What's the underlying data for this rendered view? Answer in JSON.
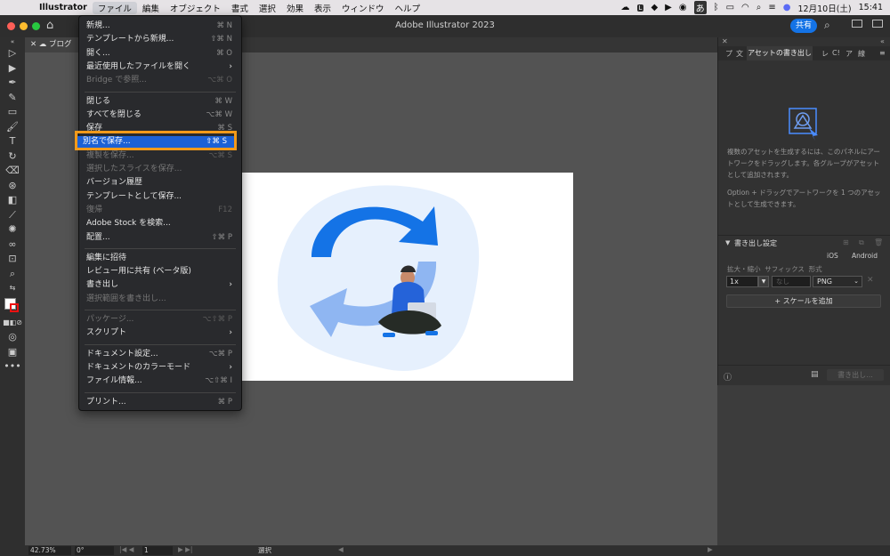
{
  "menubar": {
    "app_name": "Illustrator",
    "items": [
      "ファイル",
      "編集",
      "オブジェクト",
      "書式",
      "選択",
      "効果",
      "表示",
      "ウィンドウ",
      "ヘルプ"
    ],
    "ime": "あ",
    "date": "12月10日(土)",
    "time": "15:41"
  },
  "window": {
    "title": "Adobe Illustrator 2023",
    "share_label": "共有"
  },
  "tab": {
    "doc_name": "ブログ"
  },
  "file_menu": {
    "items": [
      {
        "label": "新規...",
        "shortcut": "⌘ N",
        "disabled": false
      },
      {
        "label": "テンプレートから新規...",
        "shortcut": "⇧⌘ N",
        "disabled": false
      },
      {
        "label": "開く...",
        "shortcut": "⌘ O",
        "disabled": false
      },
      {
        "label": "最近使用したファイルを開く",
        "shortcut": "",
        "submenu": true,
        "disabled": false
      },
      {
        "label": "Bridge で参照...",
        "shortcut": "⌥⌘ O",
        "disabled": true
      },
      {
        "sep": true
      },
      {
        "label": "閉じる",
        "shortcut": "⌘ W",
        "disabled": false
      },
      {
        "label": "すべてを閉じる",
        "shortcut": "⌥⌘ W",
        "disabled": false
      },
      {
        "label": "保存",
        "shortcut": "⌘ S",
        "disabled": false
      },
      {
        "label": "別名で保存...",
        "shortcut": "⇧⌘ S",
        "disabled": false,
        "highlighted": true
      },
      {
        "label": "複製を保存...",
        "shortcut": "⌥⌘ S",
        "disabled": true
      },
      {
        "label": "選択したスライスを保存...",
        "shortcut": "",
        "disabled": true
      },
      {
        "label": "バージョン履歴",
        "shortcut": "",
        "disabled": false
      },
      {
        "label": "テンプレートとして保存...",
        "shortcut": "",
        "disabled": false
      },
      {
        "label": "復帰",
        "shortcut": "F12",
        "disabled": true
      },
      {
        "label": "Adobe Stock を検索...",
        "shortcut": "",
        "disabled": false
      },
      {
        "label": "配置...",
        "shortcut": "⇧⌘ P",
        "disabled": false
      },
      {
        "sep": true
      },
      {
        "label": "編集に招待",
        "shortcut": "",
        "disabled": false
      },
      {
        "label": "レビュー用に共有 (ベータ版)",
        "shortcut": "",
        "disabled": false
      },
      {
        "label": "書き出し",
        "shortcut": "",
        "submenu": true,
        "disabled": false
      },
      {
        "label": "選択範囲を書き出し...",
        "shortcut": "",
        "disabled": true
      },
      {
        "sep": true
      },
      {
        "label": "パッケージ...",
        "shortcut": "⌥⇧⌘ P",
        "disabled": true
      },
      {
        "label": "スクリプト",
        "shortcut": "",
        "submenu": true,
        "disabled": false
      },
      {
        "sep": true
      },
      {
        "label": "ドキュメント設定...",
        "shortcut": "⌥⌘ P",
        "disabled": false
      },
      {
        "label": "ドキュメントのカラーモード",
        "shortcut": "",
        "submenu": true,
        "disabled": false
      },
      {
        "label": "ファイル情報...",
        "shortcut": "⌥⇧⌘ I",
        "disabled": false
      },
      {
        "sep": true
      },
      {
        "label": "プリント...",
        "shortcut": "⌘ P",
        "disabled": false
      }
    ]
  },
  "right_panel": {
    "tabs": [
      "プ",
      "文",
      "レ",
      "C!",
      "ア",
      "線"
    ],
    "active_tab": "アセットの書き出し",
    "info1": "複数のアセットを生成するには、このパネルにアートワークをドラッグします。各グループがアセットとして追加されます。",
    "info2": "Option + ドラッグでアートワークを 1 つのアセットとして生成できます。",
    "export_settings_label": "書き出し設定",
    "ios_label": "iOS",
    "android_label": "Android",
    "columns": "拡大・縮小  サフィックス  形式",
    "scale_value": "1x",
    "suffix_placeholder": "なし",
    "format_value": "PNG",
    "add_scale_label": "スケールを追加",
    "export_button_label": "書き出し..."
  },
  "status": {
    "zoom": "42.73%",
    "rotation": "0°",
    "artboard": "1",
    "tool": "選択"
  },
  "colors": {
    "accent": "#1c61d5",
    "highlight_box": "#f39a1a",
    "share": "#1473e6"
  }
}
